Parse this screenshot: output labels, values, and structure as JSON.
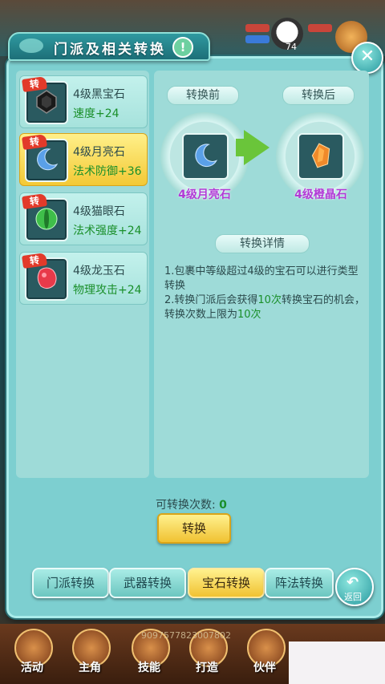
{
  "header": {
    "title": "门派及相关转换",
    "info_symbol": "!"
  },
  "hud": {
    "level_text": "74"
  },
  "gem_list": [
    {
      "badge": "转",
      "name": "4级黑宝石",
      "attribute": "速度+24",
      "icon": "black-gem-icon",
      "color": "#2a2a2a",
      "selected": false
    },
    {
      "badge": "转",
      "name": "4级月亮石",
      "attribute": "法术防御+36",
      "icon": "moon-stone-icon",
      "color": "#5aa0e8",
      "selected": true
    },
    {
      "badge": "转",
      "name": "4级猫眼石",
      "attribute": "法术强度+24",
      "icon": "cat-eye-stone-icon",
      "color": "#3fbf4a",
      "selected": false
    },
    {
      "badge": "转",
      "name": "4级龙玉石",
      "attribute": "物理攻击+24",
      "icon": "dragon-jade-icon",
      "color": "#e83a4a",
      "selected": false
    }
  ],
  "conversion": {
    "before_label": "转换前",
    "after_label": "转换后",
    "before_gem": "4级月亮石",
    "after_gem": "4级橙晶石",
    "details_title": "转换详情",
    "detail_line1": "1.包裹中等级超过4级的宝石可以进行类型转换",
    "detail_line2_a": "2.转换门派后会获得",
    "detail_line2_hl": "10次",
    "detail_line2_b": "转换宝石的机会，转换次数上限为",
    "detail_line2_hl2": "10次"
  },
  "count": {
    "label": "可转换次数:",
    "value": "0"
  },
  "convert_button": "转换",
  "tabs": [
    {
      "label": "门派转换",
      "active": false
    },
    {
      "label": "武器转换",
      "active": false
    },
    {
      "label": "宝石转换",
      "active": true
    },
    {
      "label": "阵法转换",
      "active": false
    }
  ],
  "back_button": {
    "symbol": "↶",
    "label": "返回"
  },
  "bottom_nav": [
    "活动",
    "主角",
    "技能",
    "打造",
    "伙伴"
  ],
  "user_id": "9097577823007802",
  "colors": {
    "panel": "#7dcfd0",
    "selected": "#f3c935",
    "attribute_green": "#1a8f2a",
    "gem_label_purple": "#b13ad6"
  }
}
